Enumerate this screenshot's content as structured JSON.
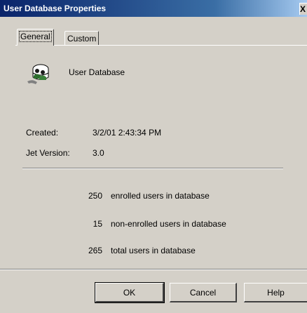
{
  "window": {
    "title": "User Database Properties",
    "close_label": "X"
  },
  "tabs": [
    {
      "label": "General",
      "active": true
    },
    {
      "label": "Custom",
      "active": false
    }
  ],
  "header": {
    "icon": "user-database-icon",
    "name": "User Database"
  },
  "details": {
    "created_label": "Created:",
    "created_value": "3/2/01 2:43:34 PM",
    "jet_label": "Jet Version:",
    "jet_value": "3.0"
  },
  "stats": [
    {
      "count": "250",
      "text": "enrolled users in database"
    },
    {
      "count": "15",
      "text": "non-enrolled users in database"
    },
    {
      "count": "265",
      "text": "total users in database"
    }
  ],
  "buttons": {
    "ok": "OK",
    "cancel": "Cancel",
    "help": "Help"
  },
  "colors": {
    "title_bar": "#0a246a",
    "dialog_face": "#d4d0c8"
  }
}
